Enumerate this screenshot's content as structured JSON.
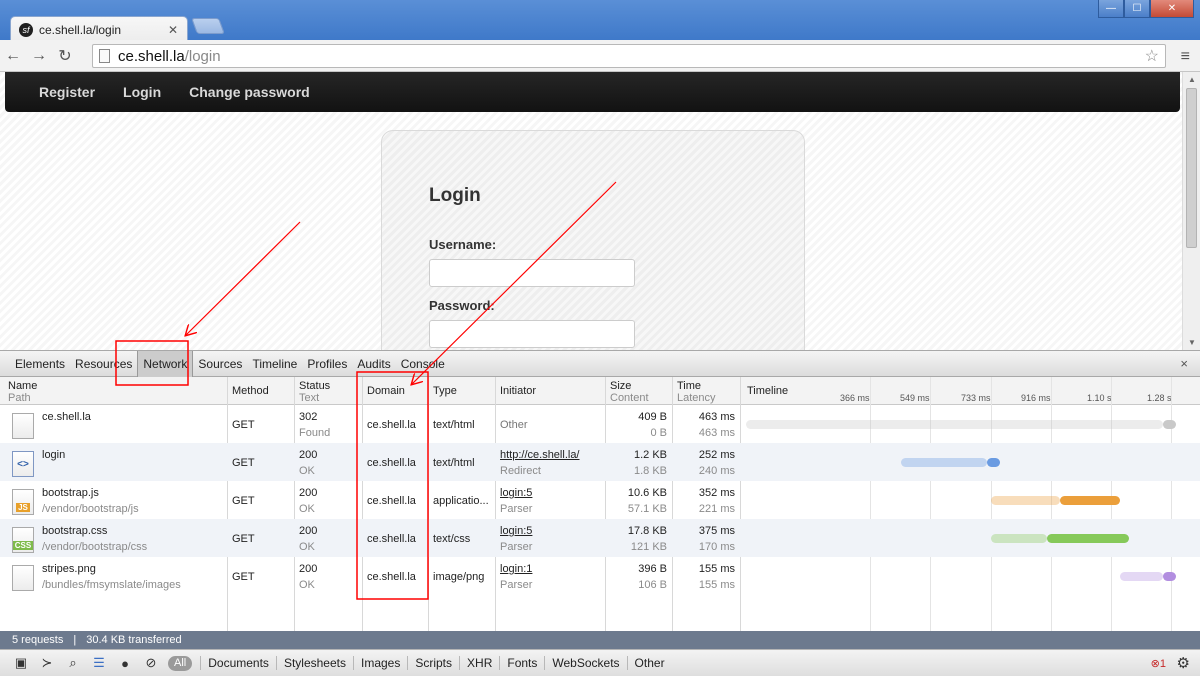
{
  "browser": {
    "tab_title": "ce.shell.la/login",
    "url_host": "ce.shell.la",
    "url_path": "/login",
    "tab_close": "✕",
    "back": "←",
    "forward": "→",
    "reload": "↻",
    "star": "☆",
    "menu": "≡",
    "win_min": "—",
    "win_max": "☐",
    "win_close": "✕"
  },
  "site": {
    "nav": [
      "Register",
      "Login",
      "Change password"
    ],
    "login_title": "Login",
    "username_label": "Username:",
    "password_label": "Password:"
  },
  "devtools": {
    "tabs": [
      "Elements",
      "Resources",
      "Network",
      "Sources",
      "Timeline",
      "Profiles",
      "Audits",
      "Console"
    ],
    "active_tab": "Network",
    "close": "×",
    "columns": {
      "name": "Name",
      "path": "Path",
      "method": "Method",
      "status": "Status",
      "status_text": "Text",
      "domain": "Domain",
      "type": "Type",
      "initiator": "Initiator",
      "size": "Size",
      "content": "Content",
      "time": "Time",
      "latency": "Latency",
      "timeline": "Timeline"
    },
    "timeline_ticks": [
      "366 ms",
      "549 ms",
      "733 ms",
      "916 ms",
      "1.10 s",
      "1.28 s"
    ],
    "requests": [
      {
        "name": "ce.shell.la",
        "path": "",
        "method": "GET",
        "status": "302",
        "status_text": "Found",
        "domain": "ce.shell.la",
        "type": "text/html",
        "initiator": "Other",
        "initiator_sub": "",
        "size": "409 B",
        "content": "0 B",
        "time": "463 ms",
        "latency": "463 ms",
        "icon": "blank-file-icon",
        "tl_start": 0.0,
        "tl_recv": 0.97,
        "tl_end": 1.0,
        "color": "#c9c9c9"
      },
      {
        "name": "login",
        "path": "",
        "method": "GET",
        "status": "200",
        "status_text": "OK",
        "domain": "ce.shell.la",
        "type": "text/html",
        "initiator": "http://ce.shell.la/",
        "initiator_sub": "Redirect",
        "size": "1.2 KB",
        "content": "1.8 KB",
        "time": "252 ms",
        "latency": "240 ms",
        "icon": "html-file-icon",
        "tl_start": 0.36,
        "tl_recv": 0.56,
        "tl_end": 0.59,
        "color": "#6a9be2"
      },
      {
        "name": "bootstrap.js",
        "path": "/vendor/bootstrap/js",
        "method": "GET",
        "status": "200",
        "status_text": "OK",
        "domain": "ce.shell.la",
        "type": "applicatio...",
        "initiator": "login:5",
        "initiator_sub": "Parser",
        "size": "10.6 KB",
        "content": "57.1 KB",
        "time": "352 ms",
        "latency": "221 ms",
        "icon": "js-file-icon",
        "tl_start": 0.57,
        "tl_recv": 0.73,
        "tl_end": 0.87,
        "color": "#eb9f3b"
      },
      {
        "name": "bootstrap.css",
        "path": "/vendor/bootstrap/css",
        "method": "GET",
        "status": "200",
        "status_text": "OK",
        "domain": "ce.shell.la",
        "type": "text/css",
        "initiator": "login:5",
        "initiator_sub": "Parser",
        "size": "17.8 KB",
        "content": "121 KB",
        "time": "375 ms",
        "latency": "170 ms",
        "icon": "css-file-icon",
        "tl_start": 0.57,
        "tl_recv": 0.7,
        "tl_end": 0.89,
        "color": "#86c95a"
      },
      {
        "name": "stripes.png",
        "path": "/bundles/fmsymslate/images",
        "method": "GET",
        "status": "200",
        "status_text": "OK",
        "domain": "ce.shell.la",
        "type": "image/png",
        "initiator": "login:1",
        "initiator_sub": "Parser",
        "size": "396 B",
        "content": "106 B",
        "time": "155 ms",
        "latency": "155 ms",
        "icon": "image-file-icon",
        "tl_start": 0.87,
        "tl_recv": 0.97,
        "tl_end": 1.0,
        "color": "#b28ee0"
      }
    ],
    "summary_requests": "5 requests",
    "summary_transferred": "30.4 KB transferred",
    "summary_sep": "|",
    "filter_all": "All",
    "filters": [
      "Documents",
      "Stylesheets",
      "Images",
      "Scripts",
      "XHR",
      "Fonts",
      "WebSockets",
      "Other"
    ],
    "error_count": "1",
    "icons": {
      "dock": "▣",
      "console_toggle": "≻",
      "search": "⌕",
      "list": "☰",
      "record": "●",
      "clear": "⊘",
      "error": "⊗",
      "settings": "⚙"
    }
  },
  "annotation_color": "#ff0000"
}
